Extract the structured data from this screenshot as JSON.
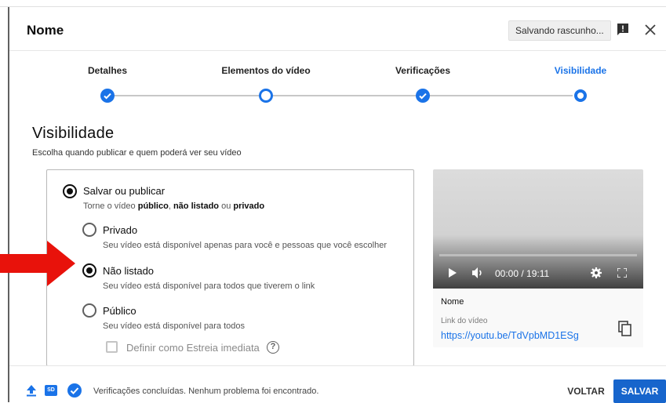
{
  "dialog": {
    "title": "Nome",
    "saving_status": "Salvando rascunho..."
  },
  "stepper": {
    "steps": [
      {
        "label": "Detalhes",
        "state": "done"
      },
      {
        "label": "Elementos do vídeo",
        "state": "current"
      },
      {
        "label": "Verificações",
        "state": "done"
      },
      {
        "label": "Visibilidade",
        "state": "active"
      }
    ]
  },
  "visibility": {
    "heading": "Visibilidade",
    "subtitle": "Escolha quando publicar e quem poderá ver seu vídeo",
    "save_publish": {
      "label": "Salvar ou publicar",
      "desc_prefix": "Torne o vídeo ",
      "desc_public": "público",
      "desc_sep1": ", ",
      "desc_unlisted": "não listado",
      "desc_sep2": " ou ",
      "desc_private": "privado",
      "selected": true
    },
    "options": [
      {
        "label": "Privado",
        "desc": "Seu vídeo está disponível apenas para você e pessoas que você escolher",
        "selected": false
      },
      {
        "label": "Não listado",
        "desc": "Seu vídeo está disponível para todos que tiverem o link",
        "selected": true
      },
      {
        "label": "Público",
        "desc": "Seu vídeo está disponível para todos",
        "selected": false
      }
    ],
    "premiere_label": "Definir como Estreia imediata",
    "help_glyph": "?"
  },
  "preview": {
    "time": "00:00 / 19:11",
    "name": "Nome",
    "link_label": "Link do vídeo",
    "link_url": "https://youtu.be/TdVpbMD1ESg",
    "progress": 0
  },
  "footer": {
    "sd_badge": "SD",
    "status_text": "Verificações concluídas. Nenhum problema foi encontrado.",
    "back_label": "VOLTAR",
    "save_label": "SALVAR"
  },
  "colors": {
    "accent": "#1a73e8",
    "save_button": "#1765cc",
    "arrow": "#e8120b"
  },
  "icons": [
    "feedback-icon",
    "close-icon",
    "play-icon",
    "volume-icon",
    "settings-icon",
    "fullscreen-icon",
    "copy-icon",
    "upload-icon",
    "sd-icon",
    "check-circle-icon",
    "help-icon",
    "red-arrow-annotation"
  ]
}
